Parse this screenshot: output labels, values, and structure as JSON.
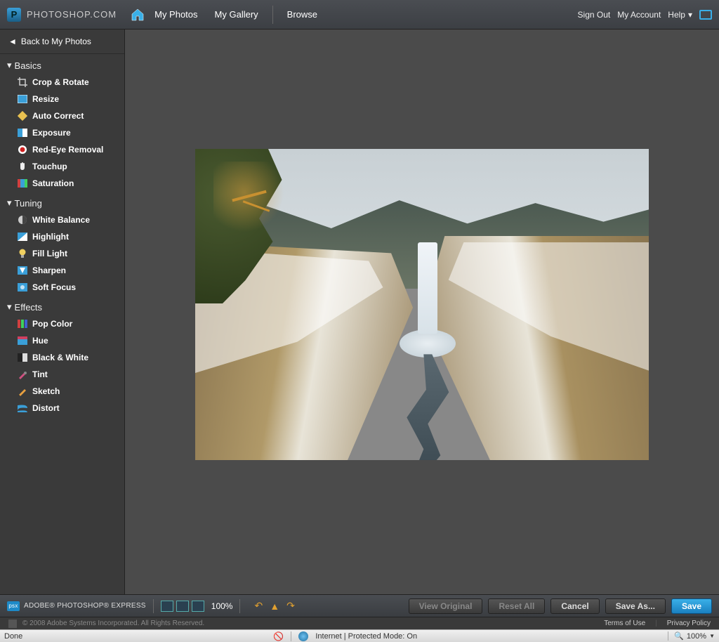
{
  "header": {
    "brand": "PHOTOSHOP.COM",
    "nav": {
      "my_photos": "My Photos",
      "my_gallery": "My Gallery",
      "browse": "Browse"
    },
    "right": {
      "sign_out": "Sign Out",
      "my_account": "My Account",
      "help": "Help"
    }
  },
  "sidebar": {
    "back": "Back to My Photos",
    "sections": {
      "basics": {
        "title": "Basics",
        "items": [
          "Crop & Rotate",
          "Resize",
          "Auto Correct",
          "Exposure",
          "Red-Eye Removal",
          "Touchup",
          "Saturation"
        ]
      },
      "tuning": {
        "title": "Tuning",
        "items": [
          "White Balance",
          "Highlight",
          "Fill Light",
          "Sharpen",
          "Soft Focus"
        ]
      },
      "effects": {
        "title": "Effects",
        "items": [
          "Pop Color",
          "Hue",
          "Black & White",
          "Tint",
          "Sketch",
          "Distort"
        ]
      }
    }
  },
  "bottombar": {
    "brand": "ADOBE® PHOTOSHOP® EXPRESS",
    "zoom": "100%",
    "buttons": {
      "view_original": "View Original",
      "reset_all": "Reset All",
      "cancel": "Cancel",
      "save_as": "Save As...",
      "save": "Save"
    }
  },
  "footer": {
    "copyright": "© 2008 Adobe Systems Incorporated. All Rights Reserved.",
    "terms": "Terms of Use",
    "privacy": "Privacy Policy"
  },
  "statusbar": {
    "done": "Done",
    "zone": "Internet | Protected Mode: On",
    "zoom": "100%"
  }
}
